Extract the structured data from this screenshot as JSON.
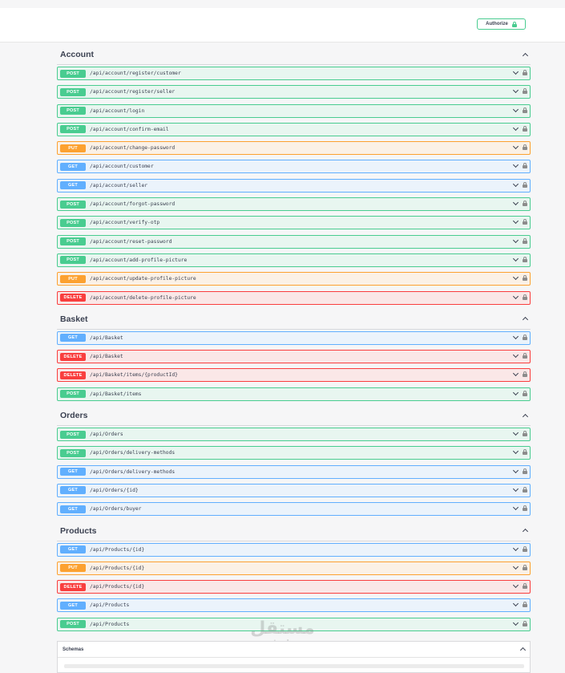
{
  "topbar": {
    "authorize_label": "Authorize"
  },
  "sections": [
    {
      "title": "Account",
      "ops": [
        {
          "method": "POST",
          "path": "/api/account/register/customer"
        },
        {
          "method": "POST",
          "path": "/api/account/register/seller"
        },
        {
          "method": "POST",
          "path": "/api/account/login"
        },
        {
          "method": "POST",
          "path": "/api/account/confirm-email"
        },
        {
          "method": "PUT",
          "path": "/api/account/change-password"
        },
        {
          "method": "GET",
          "path": "/api/account/customer"
        },
        {
          "method": "GET",
          "path": "/api/account/seller"
        },
        {
          "method": "POST",
          "path": "/api/account/forgot-password"
        },
        {
          "method": "POST",
          "path": "/api/account/verify-otp"
        },
        {
          "method": "POST",
          "path": "/api/account/reset-password"
        },
        {
          "method": "POST",
          "path": "/api/account/add-profile-picture"
        },
        {
          "method": "PUT",
          "path": "/api/account/update-profile-picture"
        },
        {
          "method": "DELETE",
          "path": "/api/account/delete-profile-picture"
        }
      ]
    },
    {
      "title": "Basket",
      "ops": [
        {
          "method": "GET",
          "path": "/api/Basket"
        },
        {
          "method": "DELETE",
          "path": "/api/Basket"
        },
        {
          "method": "DELETE",
          "path": "/api/Basket/items/{productId}"
        },
        {
          "method": "POST",
          "path": "/api/Basket/items"
        }
      ]
    },
    {
      "title": "Orders",
      "ops": [
        {
          "method": "POST",
          "path": "/api/Orders"
        },
        {
          "method": "POST",
          "path": "/api/Orders/delivery-methods"
        },
        {
          "method": "GET",
          "path": "/api/Orders/delivery-methods"
        },
        {
          "method": "GET",
          "path": "/api/Orders/{id}"
        },
        {
          "method": "GET",
          "path": "/api/Orders/buyer"
        }
      ]
    },
    {
      "title": "Products",
      "ops": [
        {
          "method": "GET",
          "path": "/api/Products/{id}"
        },
        {
          "method": "PUT",
          "path": "/api/Products/{id}"
        },
        {
          "method": "DELETE",
          "path": "/api/Products/{id}"
        },
        {
          "method": "GET",
          "path": "/api/Products"
        },
        {
          "method": "POST",
          "path": "/api/Products"
        }
      ]
    }
  ],
  "schemas": {
    "title": "Schemas"
  },
  "watermark": {
    "arabic": "مستقل",
    "latin": "mostaql.com"
  },
  "colors": {
    "post": "#49cc90",
    "put": "#fca130",
    "get": "#61affe",
    "delete": "#f93e3e"
  },
  "icons": {
    "authorize": "lock-icon",
    "expand": "chevron-down-icon",
    "collapse": "chevron-up-icon"
  }
}
